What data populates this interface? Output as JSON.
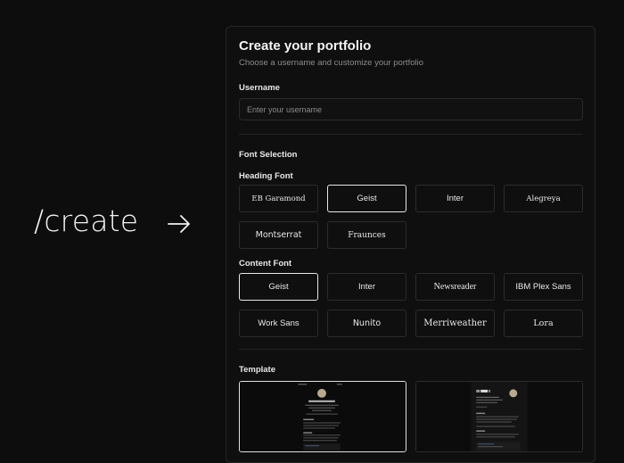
{
  "route": {
    "text": "/create",
    "arrow_icon": "arrow-right-icon"
  },
  "form": {
    "title": "Create your portfolio",
    "subtitle": "Choose a username and customize your portfolio",
    "username": {
      "label": "Username",
      "value": "",
      "placeholder": "Enter your username"
    },
    "font_section_title": "Font Selection",
    "heading_font": {
      "label": "Heading Font",
      "selected": "Geist",
      "options": [
        "EB Garamond",
        "Geist",
        "Inter",
        "Alegreya",
        "Montserrat",
        "Fraunces"
      ]
    },
    "content_font": {
      "label": "Content Font",
      "selected": "Geist",
      "options": [
        "Geist",
        "Inter",
        "Newsreader",
        "IBM Plex Sans",
        "Work Sans",
        "Nunito",
        "Merriweather",
        "Lora"
      ]
    },
    "template": {
      "label": "Template",
      "selected_index": 0
    }
  },
  "colors": {
    "background": "#0d0d0d",
    "panel": "#0f0f0f",
    "border": "#2c2c2c",
    "selected_border": "#e8e8e8"
  }
}
